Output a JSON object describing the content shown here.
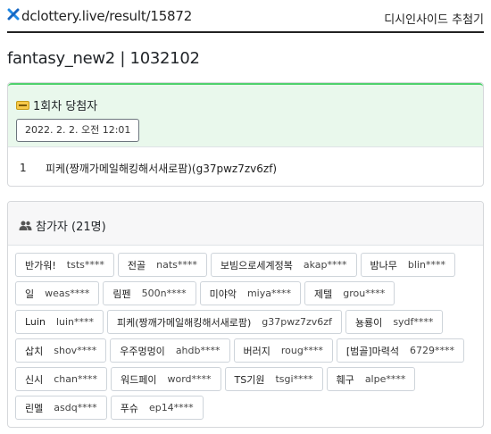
{
  "header": {
    "site_url": "dclottery.live/result/15872",
    "nav_link": "디시인사이드 추첨기",
    "logo_icon": "x-logo-icon"
  },
  "page": {
    "title": "fantasy_new2 | 1032102"
  },
  "winners": {
    "title": "1회차 당첨자",
    "date": "2022. 2. 2. 오전 12:01",
    "entries": [
      {
        "rank": "1",
        "name": "피케(짱깨가메일해킹해서새로팜)(g37pwz7zv6zf)"
      }
    ]
  },
  "participants": {
    "title": "참가자 (21명)",
    "items": [
      {
        "name": "반가워!",
        "id": "tsts****"
      },
      {
        "name": "전골",
        "id": "nats****"
      },
      {
        "name": "보빔으로세계정복",
        "id": "akap****"
      },
      {
        "name": "밤나무",
        "id": "blin****"
      },
      {
        "name": "일",
        "id": "weas****"
      },
      {
        "name": "림펜",
        "id": "500n****"
      },
      {
        "name": "미야악",
        "id": "miya****"
      },
      {
        "name": "제텔",
        "id": "grou****"
      },
      {
        "name": "Luin",
        "id": "luin****"
      },
      {
        "name": "피케(짱깨가메일해킹해서새로팜)",
        "id": "g37pwz7zv6zf"
      },
      {
        "name": "뇽룡이",
        "id": "sydf****"
      },
      {
        "name": "삽치",
        "id": "shov****"
      },
      {
        "name": "우주멍멍이",
        "id": "ahdb****"
      },
      {
        "name": "버러지",
        "id": "roug****"
      },
      {
        "name": "[범골]마력석",
        "id": "6729****"
      },
      {
        "name": "신시",
        "id": "chan****"
      },
      {
        "name": "워드페이",
        "id": "word****"
      },
      {
        "name": "TS기원",
        "id": "tsgi****"
      },
      {
        "name": "훼구",
        "id": "alpe****"
      },
      {
        "name": "린멜",
        "id": "asdq****"
      },
      {
        "name": "푸슈",
        "id": "ep14****"
      }
    ]
  }
}
